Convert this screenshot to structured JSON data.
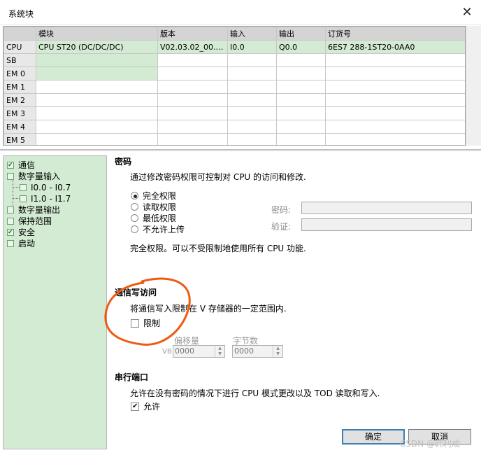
{
  "window": {
    "title": "系统块",
    "close_glyph": "✕"
  },
  "grid": {
    "headers": [
      "",
      "模块",
      "版本",
      "输入",
      "输出",
      "订货号"
    ],
    "rows": [
      {
        "slot": "CPU",
        "module": "CPU ST20 (DC/DC/DC)",
        "version": "V02.03.02_00.00...",
        "input": "I0.0",
        "output": "Q0.0",
        "order": "6ES7 288-1ST20-0AA0"
      },
      {
        "slot": "SB",
        "module": "",
        "version": "",
        "input": "",
        "output": "",
        "order": ""
      },
      {
        "slot": "EM 0",
        "module": "",
        "version": "",
        "input": "",
        "output": "",
        "order": ""
      },
      {
        "slot": "EM 1",
        "module": "",
        "version": "",
        "input": "",
        "output": "",
        "order": ""
      },
      {
        "slot": "EM 2",
        "module": "",
        "version": "",
        "input": "",
        "output": "",
        "order": ""
      },
      {
        "slot": "EM 3",
        "module": "",
        "version": "",
        "input": "",
        "output": "",
        "order": ""
      },
      {
        "slot": "EM 4",
        "module": "",
        "version": "",
        "input": "",
        "output": "",
        "order": ""
      },
      {
        "slot": "EM 5",
        "module": "",
        "version": "",
        "input": "",
        "output": "",
        "order": ""
      }
    ]
  },
  "tree": {
    "items": [
      {
        "label": "通信",
        "checked": true
      },
      {
        "label": "数字量输入",
        "checked": false
      },
      {
        "label": "I0.0 - I0.7",
        "checked": false
      },
      {
        "label": "I1.0 - I1.7",
        "checked": false
      },
      {
        "label": "数字量输出",
        "checked": false
      },
      {
        "label": "保持范围",
        "checked": false
      },
      {
        "label": "安全",
        "checked": true
      },
      {
        "label": "启动",
        "checked": false
      }
    ]
  },
  "password": {
    "title": "密码",
    "desc": "通过修改密码权限可控制对 CPU 的访问和修改.",
    "options": [
      "完全权限",
      "读取权限",
      "最低权限",
      "不允许上传"
    ],
    "selected_index": 0,
    "password_label": "密码:",
    "verify_label": "验证:",
    "info": "完全权限。可以不受限制地使用所有 CPU 功能."
  },
  "comm_write": {
    "title": "通信写访问",
    "desc": "将通信写入限制在 V 存储器的一定范围内.",
    "restrict_label": "限制",
    "restrict_checked": false,
    "offset_label": "偏移量",
    "vb_label": "VB",
    "offset_value": "0000",
    "bytes_label": "字节数",
    "bytes_value": "0000"
  },
  "serial": {
    "title": "串行端口",
    "desc": "允许在没有密码的情况下进行 CPU 模式更改以及 TOD 读取和写入.",
    "allow_label": "允许",
    "allow_checked": true
  },
  "buttons": {
    "ok": "确定",
    "cancel": "取消"
  },
  "watermark": "CSDN @韩利成",
  "colors": {
    "tree_bg": "#d3ead3",
    "annotation": "#f05a10",
    "primary_border": "#3c7fb1"
  }
}
